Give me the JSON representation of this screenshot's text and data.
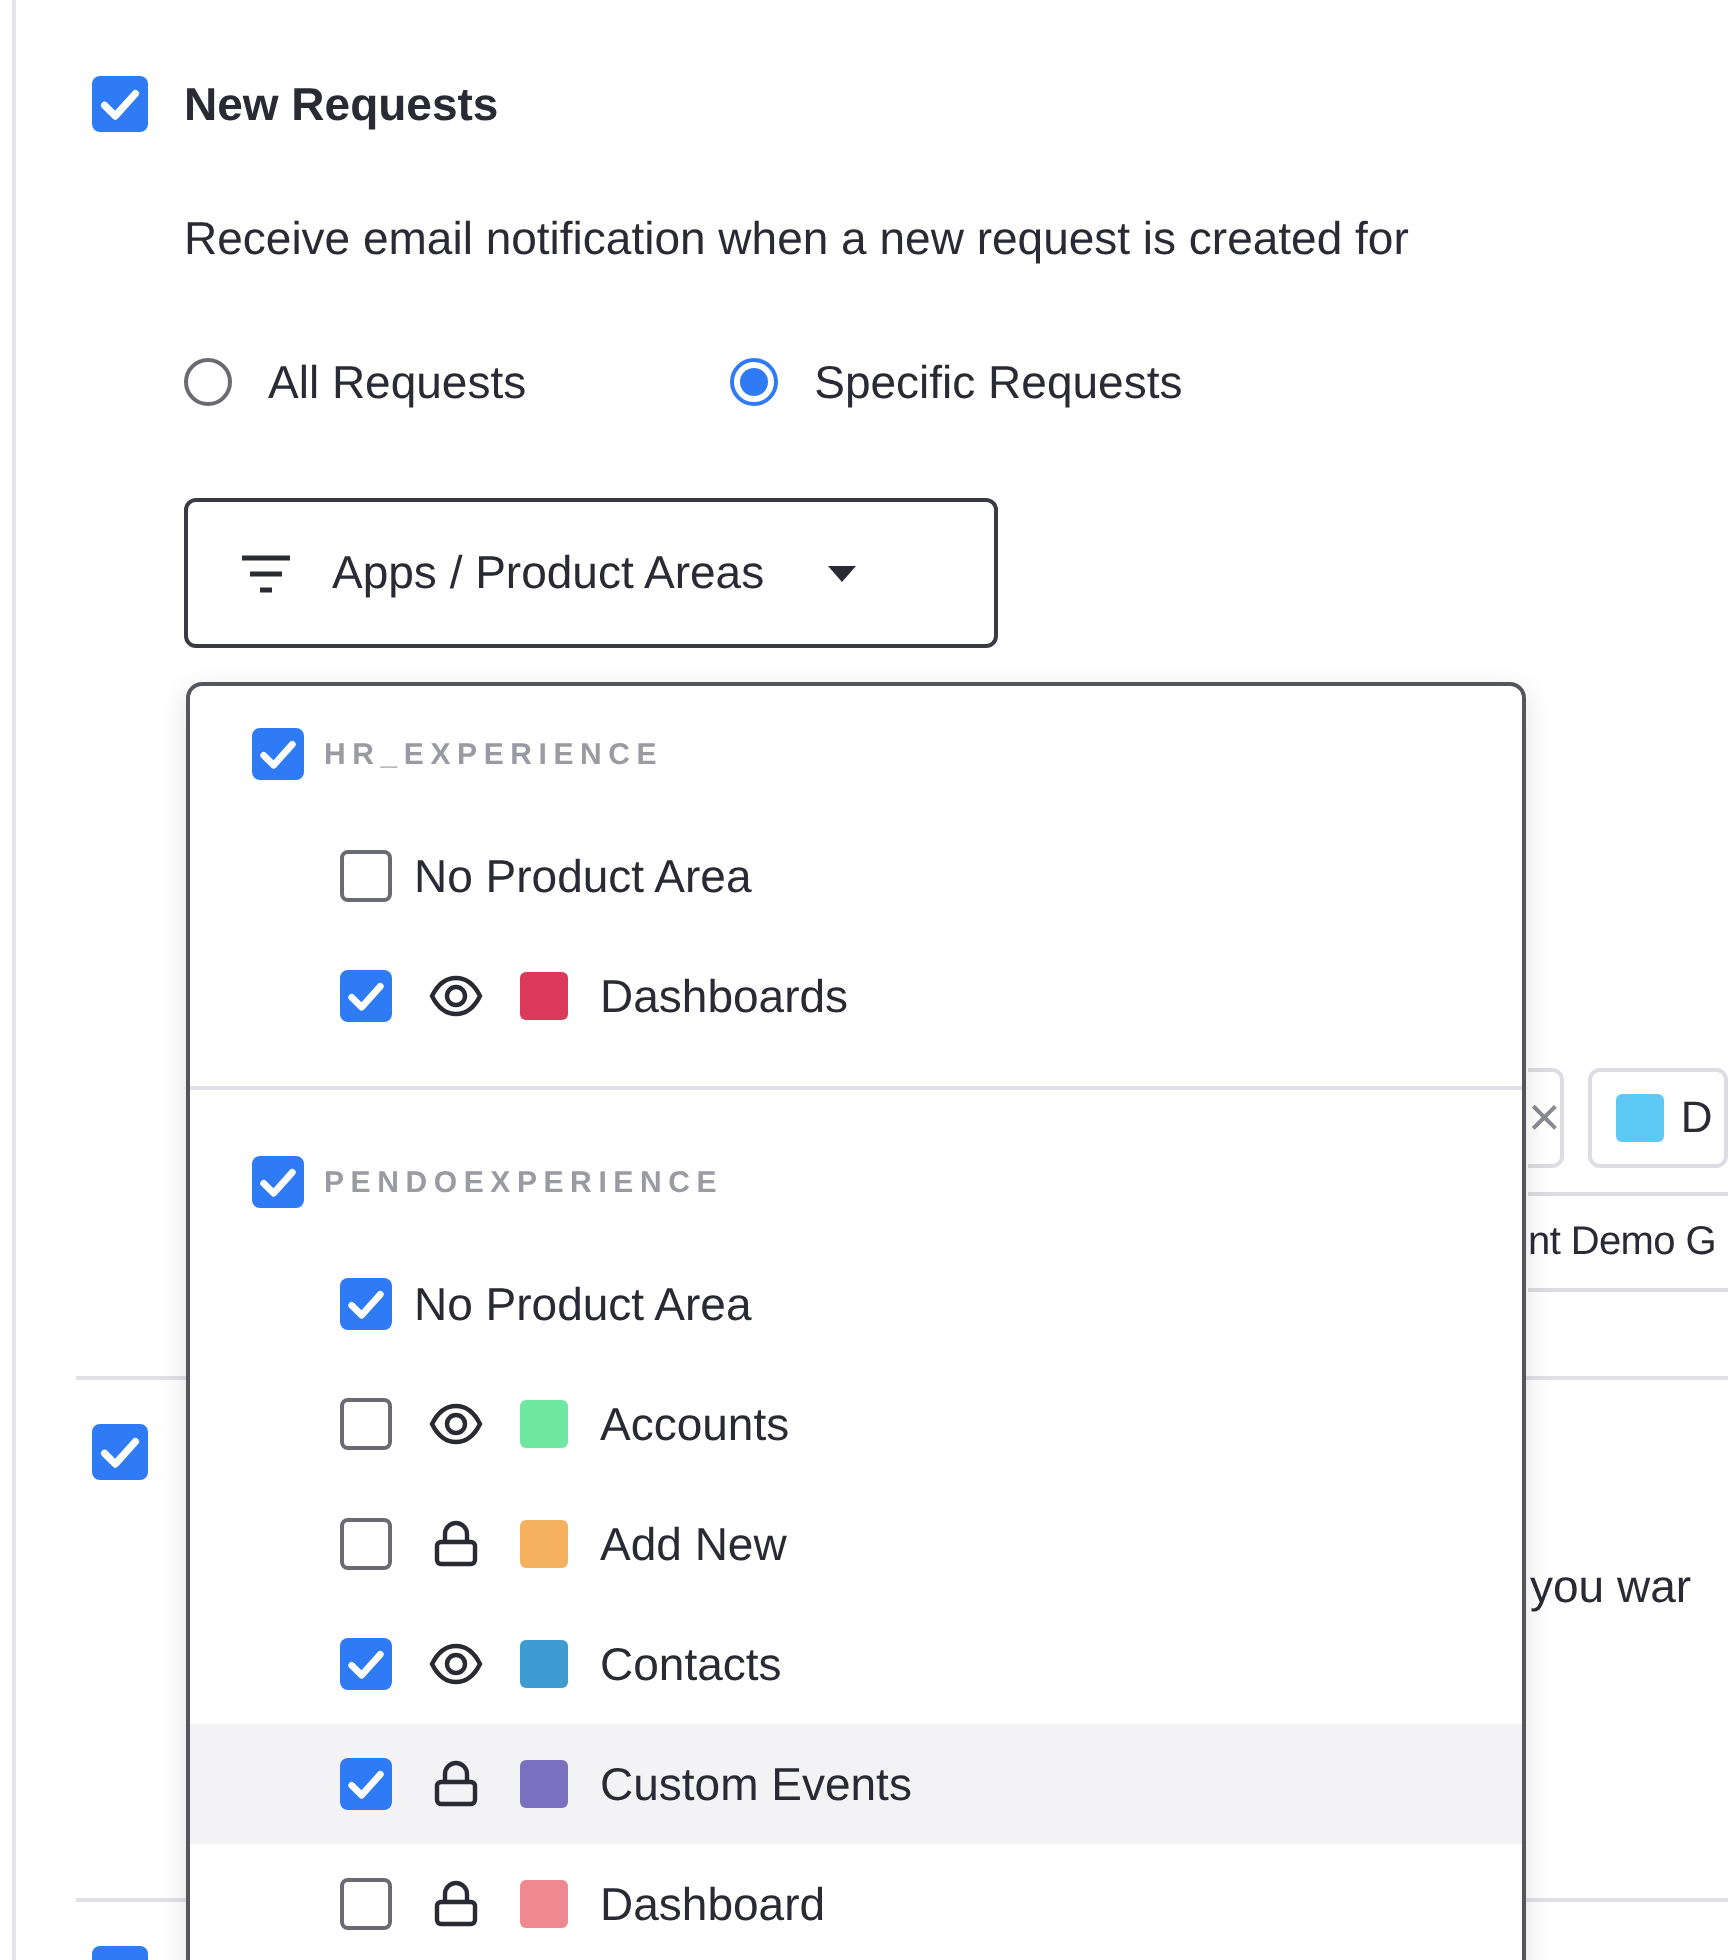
{
  "sections": [
    {
      "title": "New Requests",
      "checked": true,
      "description": "Receive email notification when a new request is created for",
      "options": [
        {
          "label": "All Requests",
          "selected": false
        },
        {
          "label": "Specific Requests",
          "selected": true
        }
      ],
      "filter_button": {
        "label": "Apps / Product Areas"
      },
      "chip_rows": [
        [
          {
            "kind": "close-fragment",
            "text": "×"
          },
          {
            "kind": "chip",
            "text": "D",
            "color": "#5ec8f5"
          }
        ],
        [
          {
            "kind": "text-fragment",
            "text": "nt Demo G"
          }
        ]
      ]
    },
    {
      "checked": true,
      "description_fragment": "you war"
    },
    {
      "checked": true
    }
  ],
  "dropdown": {
    "groups": [
      {
        "name": "HR_EXPERIENCE",
        "checked": true,
        "items": [
          {
            "label": "No Product Area",
            "checked": false,
            "kind": "plain",
            "highlighted": false
          },
          {
            "label": "Dashboards",
            "checked": true,
            "kind": "visible",
            "color": "#db3a5a",
            "highlighted": false
          }
        ]
      },
      {
        "name": "PENDOEXPERIENCE",
        "checked": true,
        "items": [
          {
            "label": "No Product Area",
            "checked": true,
            "kind": "plain",
            "highlighted": false
          },
          {
            "label": "Accounts",
            "checked": false,
            "kind": "visible",
            "color": "#6ee7a0",
            "highlighted": false
          },
          {
            "label": "Add New",
            "checked": false,
            "kind": "locked",
            "color": "#f5b060",
            "highlighted": false
          },
          {
            "label": "Contacts",
            "checked": true,
            "kind": "visible",
            "color": "#3e9ad0",
            "highlighted": false
          },
          {
            "label": "Custom Events",
            "checked": true,
            "kind": "locked",
            "color": "#7b6fc0",
            "highlighted": true
          },
          {
            "label": "Dashboard",
            "checked": false,
            "kind": "locked",
            "color": "#f08890",
            "highlighted": false
          }
        ]
      }
    ]
  }
}
